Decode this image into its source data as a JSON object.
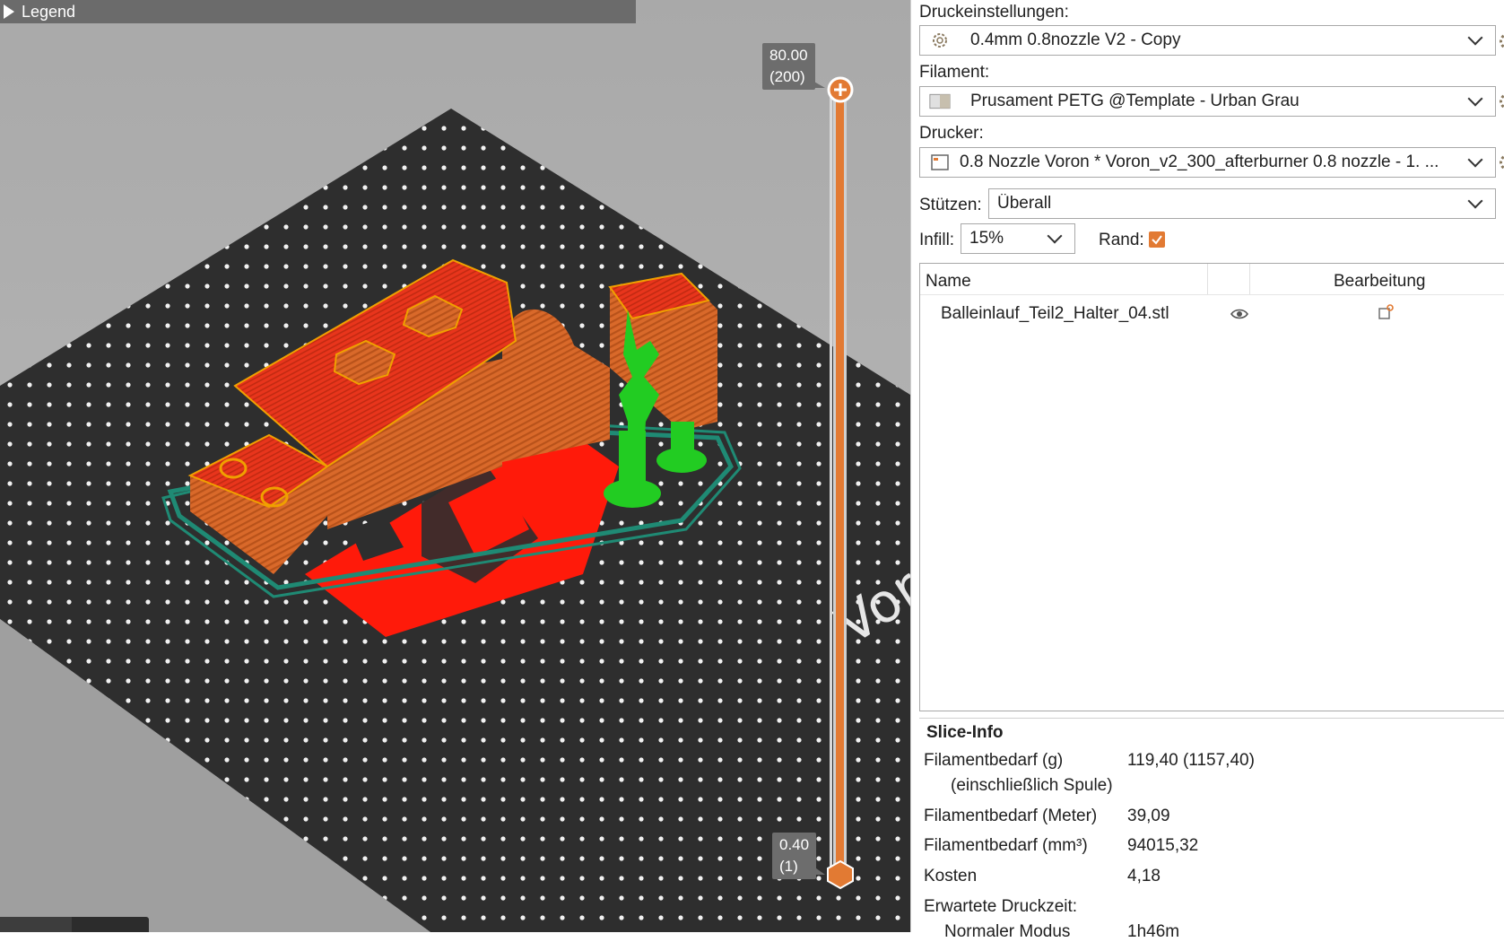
{
  "viewport": {
    "legend_label": "Legend",
    "layer_top_value": "80.00",
    "layer_top_index": "(200)",
    "layer_bottom_value": "0.40",
    "layer_bottom_index": "(1)",
    "bed_logo_text": "Voron",
    "colors": {
      "accent": "#e27a33",
      "bed": "#2f2f2f",
      "part": "#d2691e",
      "top_surface": "#e83a1a",
      "support": "#22cc22",
      "skirt": "#1f8a74",
      "bridge": "#ff1a0a"
    }
  },
  "panel": {
    "print_settings_label": "Druckeinstellungen:",
    "print_settings_value": "0.4mm 0.8nozzle V2 - Copy",
    "filament_label": "Filament:",
    "filament_value": "Prusament PETG @Template - Urban Grau",
    "printer_label": "Drucker:",
    "printer_value": "0.8 Nozzle Voron  * Voron_v2_300_afterburner 0.8 nozzle - 1. ...",
    "supports_label": "Stützen:",
    "supports_value": "Überall",
    "infill_label": "Infill:",
    "infill_value": "15%",
    "brim_label": "Rand:",
    "brim_checked": true
  },
  "object_list": {
    "col_name": "Name",
    "col_edit": "Bearbeitung",
    "rows": [
      {
        "name": "Balleinlauf_Teil2_Halter_04.stl",
        "visible_icon": "eye-icon",
        "edit_icon": "edit-icon"
      }
    ]
  },
  "slice_info": {
    "title": "Slice-Info",
    "filament_g_label": "Filamentbedarf (g)",
    "filament_g_sub": "(einschließlich Spule)",
    "filament_g_value": "119,40 (1157,40)",
    "filament_m_label": "Filamentbedarf (Meter)",
    "filament_m_value": "39,09",
    "filament_mm3_label": "Filamentbedarf (mm³)",
    "filament_mm3_value": "94015,32",
    "cost_label": "Kosten",
    "cost_value": "4,18",
    "print_time_label": "Erwartete Druckzeit:",
    "normal_mode_label": "Normaler Modus",
    "normal_mode_value": "1h46m"
  }
}
